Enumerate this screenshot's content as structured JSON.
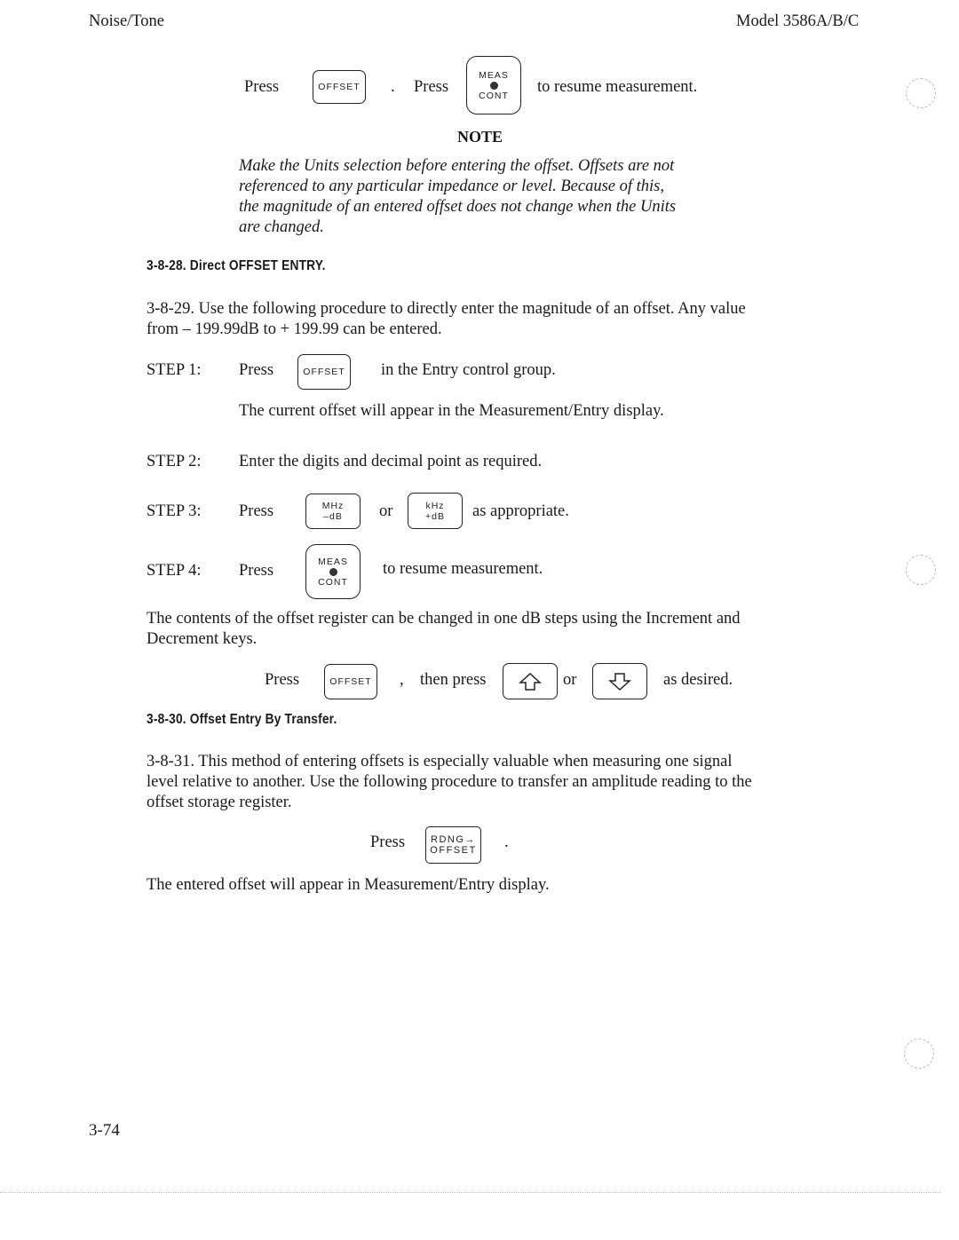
{
  "header": {
    "left": "Noise/Tone",
    "right": "Model 3586A/B/C"
  },
  "intro_line": {
    "press1": "Press",
    "key1": "OFFSET",
    "period": ".",
    "press2": "Press",
    "key2_top": "MEAS",
    "key2_bottom": "CONT",
    "suffix": "to resume measurement."
  },
  "note": {
    "title": "NOTE",
    "lines": [
      "Make the Units selection before entering the offset. Offsets are not",
      "referenced to any particular impedance or level. Because of this,",
      "the magnitude of an entered offset does not change when the Units",
      "are changed."
    ]
  },
  "section_3_8_28": {
    "heading": "3-8-28. Direct OFFSET ENTRY.",
    "paragraph_lines": [
      "3-8-29. Use the following procedure to directly enter the magnitude of an offset. Any value",
      "from  – 199.99dB to  + 199.99 can be entered."
    ],
    "steps": [
      {
        "label": "STEP 1:",
        "press": "Press",
        "key": "OFFSET",
        "text": "in the Entry control group.",
        "subtext": "The current offset will appear in the Measurement/Entry display."
      },
      {
        "label": "STEP 2:",
        "text": "Enter the digits and decimal point as required."
      },
      {
        "label": "STEP 3:",
        "press": "Press",
        "key_a_top": "MHz",
        "key_a_bottom": "–dB",
        "or": "or",
        "key_b_top": "kHz",
        "key_b_bottom": "+dB",
        "text": "as appropriate."
      },
      {
        "label": "STEP 4:",
        "press": "Press",
        "key_top": "MEAS",
        "key_bottom": "CONT",
        "text": "to resume measurement."
      }
    ],
    "increment_lines": [
      "The contents of the offset register can be changed in one dB steps using the Increment and",
      "Decrement keys."
    ],
    "increment_line": {
      "press": "Press",
      "key": "OFFSET",
      "comma": ",",
      "then": "then press",
      "up_key_icon": "up-arrow-icon",
      "or": "or",
      "down_key_icon": "down-arrow-icon",
      "suffix": "as desired."
    }
  },
  "section_3_8_30": {
    "heading": "3-8-30. Offset Entry By Transfer.",
    "paragraph_lines": [
      "3-8-31. This method of entering offsets is especially valuable when measuring one signal",
      "level relative to another. Use the following procedure to transfer an amplitude reading to the",
      "offset storage register."
    ],
    "press": "Press",
    "key_top": "RDNG→",
    "key_bottom": "OFFSET",
    "period": ".",
    "result": "The entered offset will appear in Measurement/Entry display."
  },
  "footer": {
    "page_number": "3-74"
  }
}
